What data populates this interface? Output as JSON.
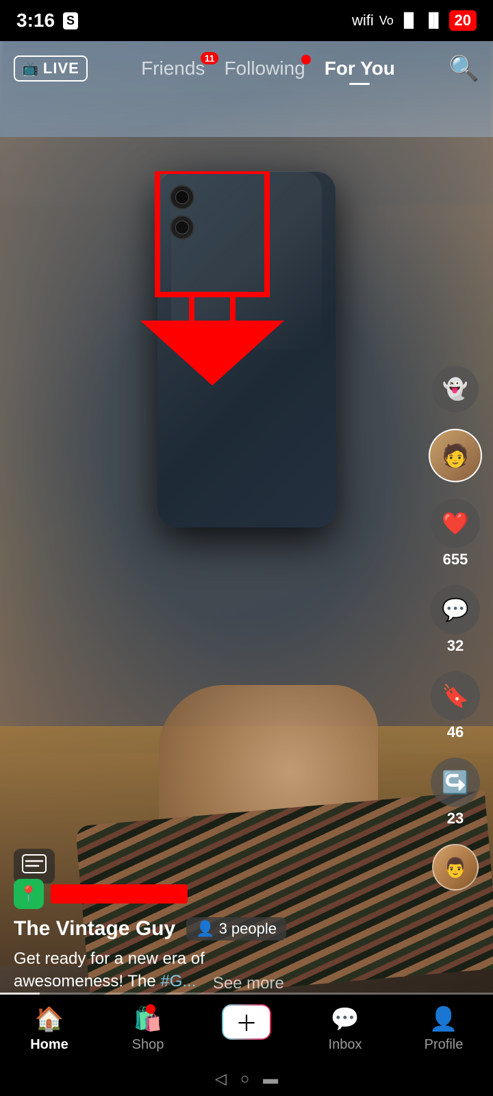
{
  "statusBar": {
    "time": "3:16",
    "battery": "20",
    "wifiIcon": "📶",
    "signalIcon": "📶"
  },
  "topNav": {
    "liveBadge": "LIVE",
    "friends": "Friends",
    "friendsNotifCount": "11",
    "following": "Following",
    "followingDot": true,
    "forYou": "For You",
    "activeTab": "forYou",
    "searchIcon": "🔍"
  },
  "rightActions": {
    "ghostLabel": "ghost",
    "avatarEmoji": "🧑",
    "likeCount": "655",
    "commentCount": "32",
    "bookmarkCount": "46",
    "shareCount": "23",
    "profileEmoji": "👨"
  },
  "videoInfo": {
    "locationIcon": "📍",
    "username": "The Vintage Guy",
    "viewersIcon": "👤",
    "viewersText": "3 people",
    "captionLine1": "Get ready for a new era of",
    "captionLine2": "awesomeness! The ",
    "captionHashtag": "#G...",
    "seeMore": "See more"
  },
  "bottomNav": {
    "homeLabel": "Home",
    "shopLabel": "Shop",
    "plusLabel": "",
    "inboxLabel": "Inbox",
    "profileLabel": "Profile",
    "shopHasNotif": true
  },
  "progressBar": {
    "percentage": 8
  }
}
